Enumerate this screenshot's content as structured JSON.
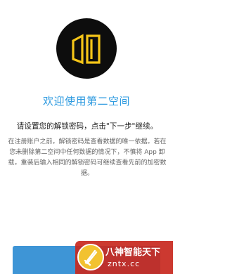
{
  "welcome": {
    "title": "欢迎使用第二空间"
  },
  "prompt": {
    "text": "请设置您的解锁密码，点击\"下一步\"继续。"
  },
  "description": {
    "text": "在注册账户之前，解锁密码是查看数据的唯一依据。若在您未删除第二空间中任何数据的情况下，不慎将 App 卸载，重装后输入相同的解锁密码可继续查看先前的加密数据。"
  },
  "logo": {
    "icon": "door-icon",
    "accent_color": "#f5c518",
    "background_color": "#0d0d0d"
  },
  "next_button": {
    "color": "#3e95d6"
  },
  "watermark": {
    "title": "八神智能天下",
    "url": "zntx.cc",
    "color": "#c8281e"
  },
  "theme": {
    "title_color": "#2f9be0"
  }
}
